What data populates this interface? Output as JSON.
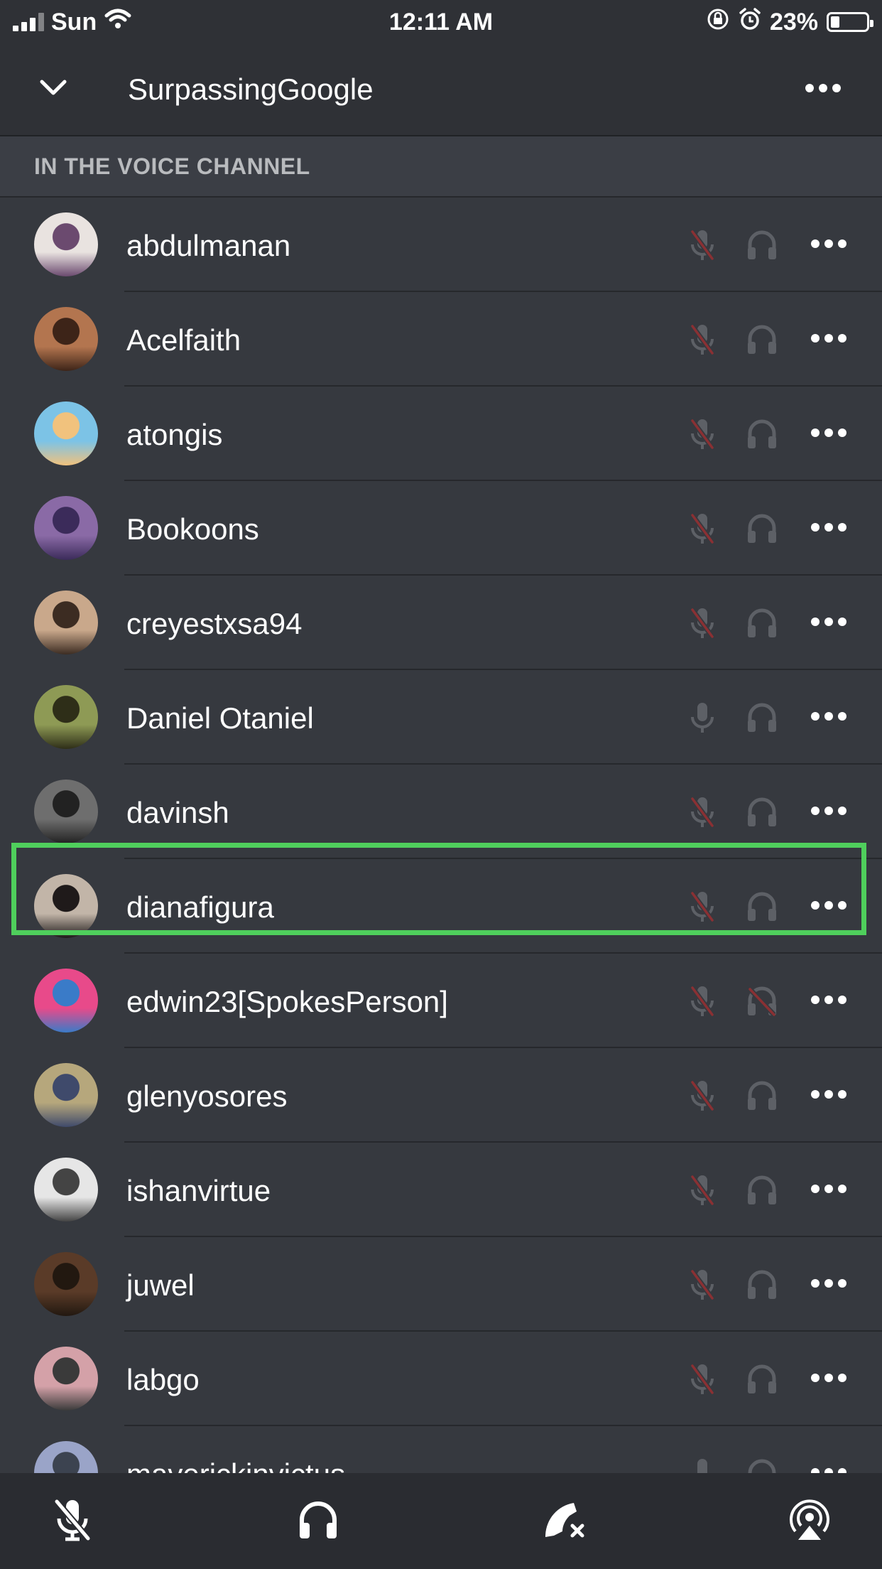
{
  "status_bar": {
    "carrier": "Sun",
    "time": "12:11 AM",
    "battery": "23%"
  },
  "header": {
    "title": "SurpassingGoogle"
  },
  "section_title": "IN THE VOICE CHANNEL",
  "colors": {
    "highlight": "#4fcf5c",
    "muted_red": "#ed4245",
    "background": "#36393f"
  },
  "members": [
    {
      "name": "abdulmanan",
      "mic": "muted",
      "headphones": "on"
    },
    {
      "name": "Acelfaith",
      "mic": "muted",
      "headphones": "on"
    },
    {
      "name": "atongis",
      "mic": "muted",
      "headphones": "on"
    },
    {
      "name": "Bookoons",
      "mic": "muted",
      "headphones": "on"
    },
    {
      "name": "creyestxsa94",
      "mic": "muted",
      "headphones": "on"
    },
    {
      "name": "Daniel Otaniel",
      "mic": "on",
      "headphones": "on"
    },
    {
      "name": "davinsh",
      "mic": "muted",
      "headphones": "on"
    },
    {
      "name": "dianafigura",
      "mic": "muted",
      "headphones": "on",
      "selected": true
    },
    {
      "name": "edwin23[SpokesPerson]",
      "mic": "muted",
      "headphones": "deafened"
    },
    {
      "name": "glenyosores",
      "mic": "muted",
      "headphones": "on"
    },
    {
      "name": "ishanvirtue",
      "mic": "muted",
      "headphones": "on"
    },
    {
      "name": "juwel",
      "mic": "muted",
      "headphones": "on"
    },
    {
      "name": "labgo",
      "mic": "muted",
      "headphones": "on"
    },
    {
      "name": "maverickinvictus",
      "mic": "on",
      "headphones": "on"
    }
  ],
  "bottom_bar": {
    "icons": [
      "mic-muted-icon",
      "headphones-icon",
      "disconnect-icon",
      "broadcast-icon"
    ]
  }
}
